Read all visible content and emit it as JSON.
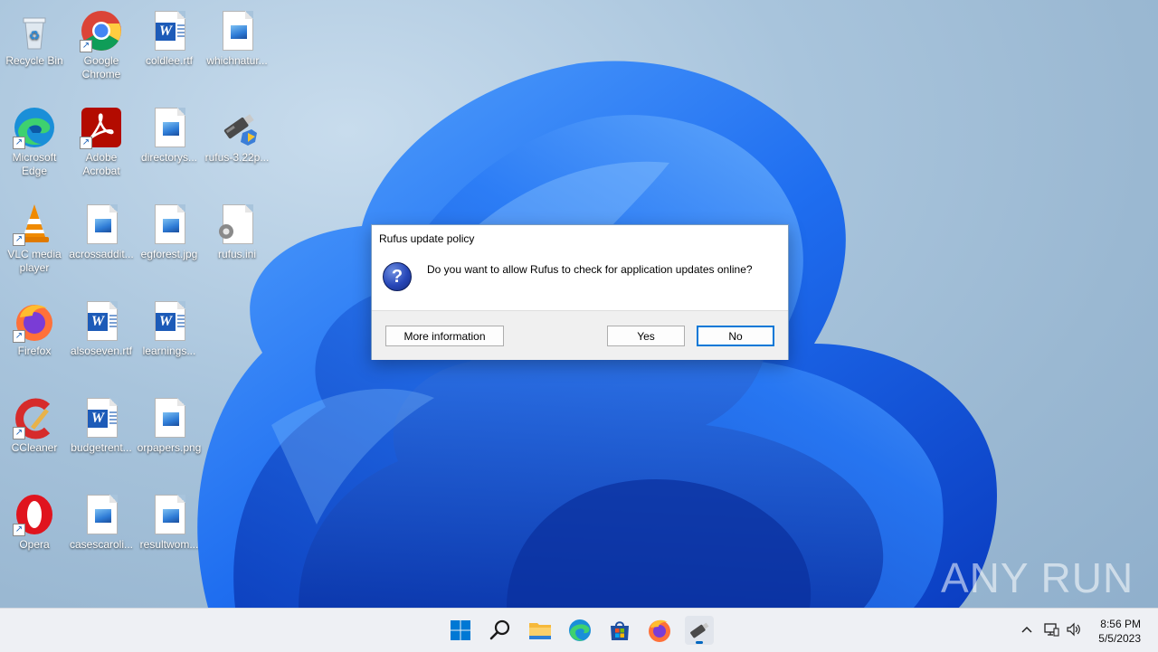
{
  "desktop": {
    "icons": [
      {
        "label": "Recycle Bin"
      },
      {
        "label": "Google Chrome"
      },
      {
        "label": "coldlee.rtf"
      },
      {
        "label": "whichnatur..."
      },
      {
        "label": "Microsoft Edge"
      },
      {
        "label": "Adobe Acrobat"
      },
      {
        "label": "directorys..."
      },
      {
        "label": "rufus-3.22p..."
      },
      {
        "label": "VLC media player"
      },
      {
        "label": "acrossaddit..."
      },
      {
        "label": "egforest.jpg"
      },
      {
        "label": "rufus.ini"
      },
      {
        "label": "Firefox"
      },
      {
        "label": "alsoseven.rtf"
      },
      {
        "label": "learnings..."
      },
      {
        "label": "CCleaner"
      },
      {
        "label": "budgetrent..."
      },
      {
        "label": "orpapers.png"
      },
      {
        "label": "Opera"
      },
      {
        "label": "casescaroli..."
      },
      {
        "label": "resultwom..."
      }
    ]
  },
  "dialog": {
    "title": "Rufus update policy",
    "message": "Do you want to allow Rufus to check for application updates online?",
    "icon": "question-icon",
    "buttons": {
      "more_info": "More information",
      "yes": "Yes",
      "no": "No"
    }
  },
  "taskbar": {
    "apps": [
      "start",
      "search",
      "file-explorer",
      "edge",
      "store",
      "firefox",
      "rufus"
    ],
    "clock": {
      "time": "8:56 PM",
      "date": "5/5/2023"
    }
  },
  "watermark": "ANY RUN",
  "colors": {
    "accent": "#0078d7",
    "wallpaper_blue": "#1e5fe0"
  }
}
